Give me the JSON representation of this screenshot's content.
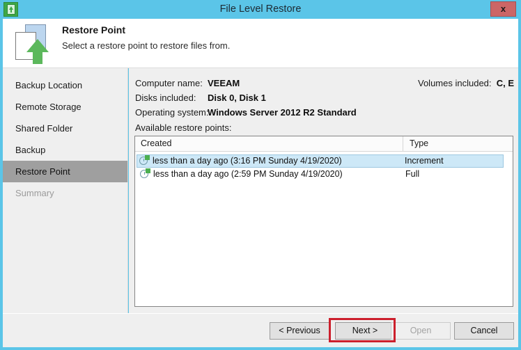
{
  "window": {
    "title": "File Level Restore",
    "app_icon": "restore-app-icon",
    "close_label": "x"
  },
  "banner": {
    "title": "Restore Point",
    "subtitle": "Select a restore point to restore files from.",
    "icon": "document-upload-icon"
  },
  "sidebar": {
    "items": [
      {
        "label": "Backup Location",
        "state": "normal"
      },
      {
        "label": "Remote Storage",
        "state": "normal"
      },
      {
        "label": "Shared Folder",
        "state": "normal"
      },
      {
        "label": "Backup",
        "state": "normal"
      },
      {
        "label": "Restore Point",
        "state": "selected"
      },
      {
        "label": "Summary",
        "state": "disabled"
      }
    ]
  },
  "info": {
    "computer_name_label": "Computer name:",
    "computer_name_value": "VEEAM",
    "disks_label": "Disks included:",
    "disks_value": "Disk 0, Disk 1",
    "os_label": "Operating system:",
    "os_value": "Windows Server 2012 R2 Standard",
    "volumes_label": "Volumes included:",
    "volumes_value": "C, E",
    "available_label": "Available restore points:"
  },
  "list": {
    "columns": [
      "Created",
      "Type"
    ],
    "rows": [
      {
        "created": "less than a day ago (3:16 PM Sunday 4/19/2020)",
        "type": "Increment",
        "selected": true,
        "icon": "restore-point-clock-icon"
      },
      {
        "created": "less than a day ago (2:59 PM Sunday 4/19/2020)",
        "type": "Full",
        "selected": false,
        "icon": "restore-point-clock-icon"
      }
    ]
  },
  "footer": {
    "previous": "< Previous",
    "next": "Next >",
    "open": "Open",
    "cancel": "Cancel"
  },
  "colors": {
    "titlebar": "#5bc5e8",
    "selection": "#cde8f7",
    "nav_selected": "#9f9f9f",
    "annotation": "#cc1f2c",
    "accent_green": "#5cb85c"
  }
}
